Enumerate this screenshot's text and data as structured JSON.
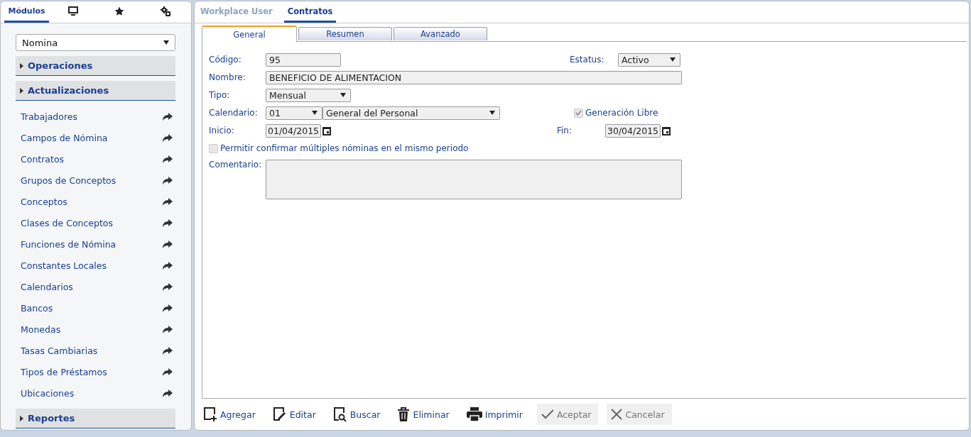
{
  "sidebar": {
    "tabs": [
      {
        "kind": "text",
        "label": "Módulos",
        "selected": true
      },
      {
        "kind": "monitor",
        "selected": false
      },
      {
        "kind": "star",
        "selected": false
      },
      {
        "kind": "gears",
        "selected": false
      }
    ],
    "module_select": "Nomina",
    "groups": [
      {
        "label": "Operaciones"
      },
      {
        "label": "Actualizaciones",
        "items": [
          "Trabajadores",
          "Campos de Nómina",
          "Contratos",
          "Grupos de Conceptos",
          "Conceptos",
          "Clases de Conceptos",
          "Funciones de Nómina",
          "Constantes Locales",
          "Calendarios",
          "Bancos",
          "Monedas",
          "Tasas Cambiarias",
          "Tipos de Préstamos",
          "Ubicaciones"
        ]
      },
      {
        "label": "Reportes"
      }
    ]
  },
  "header_tabs": [
    {
      "label": "Workplace User",
      "selected": false
    },
    {
      "label": "Contratos",
      "selected": true
    }
  ],
  "form_tabs": [
    {
      "label": "General",
      "selected": true
    },
    {
      "label": "Resumen",
      "selected": false
    },
    {
      "label": "Avanzado",
      "selected": false
    }
  ],
  "form": {
    "codigo": {
      "label": "Código:",
      "value": "95"
    },
    "estatus": {
      "label": "Estatus:",
      "value": "Activo"
    },
    "nombre": {
      "label": "Nombre:",
      "value": "BENEFICIO DE ALIMENTACION"
    },
    "tipo": {
      "label": "Tipo:",
      "value": "Mensual"
    },
    "calendario": {
      "label": "Calendario:",
      "code": "01",
      "name": "General del Personal"
    },
    "generacion_libre": {
      "label": "Generación Libre",
      "checked": true,
      "disabled": true
    },
    "inicio": {
      "label": "Inicio:",
      "value": "01/04/2015"
    },
    "fin": {
      "label": "Fin:",
      "value": "30/04/2015"
    },
    "permitir": {
      "label": "Permitir confirmar múltiples nóminas en el mismo periodo",
      "checked": false,
      "disabled": true
    },
    "comentario": {
      "label": "Comentario:"
    }
  },
  "toolbar": [
    {
      "kind": "add",
      "label": "Agregar",
      "disabled": false
    },
    {
      "kind": "edit",
      "label": "Editar",
      "disabled": false
    },
    {
      "kind": "search",
      "label": "Buscar",
      "disabled": false
    },
    {
      "kind": "delete",
      "label": "Eliminar",
      "disabled": false
    },
    {
      "kind": "print",
      "label": "Imprimir",
      "disabled": false
    },
    {
      "kind": "accept",
      "label": "Aceptar",
      "disabled": true
    },
    {
      "kind": "cancel",
      "label": "Cancelar",
      "disabled": true
    }
  ]
}
